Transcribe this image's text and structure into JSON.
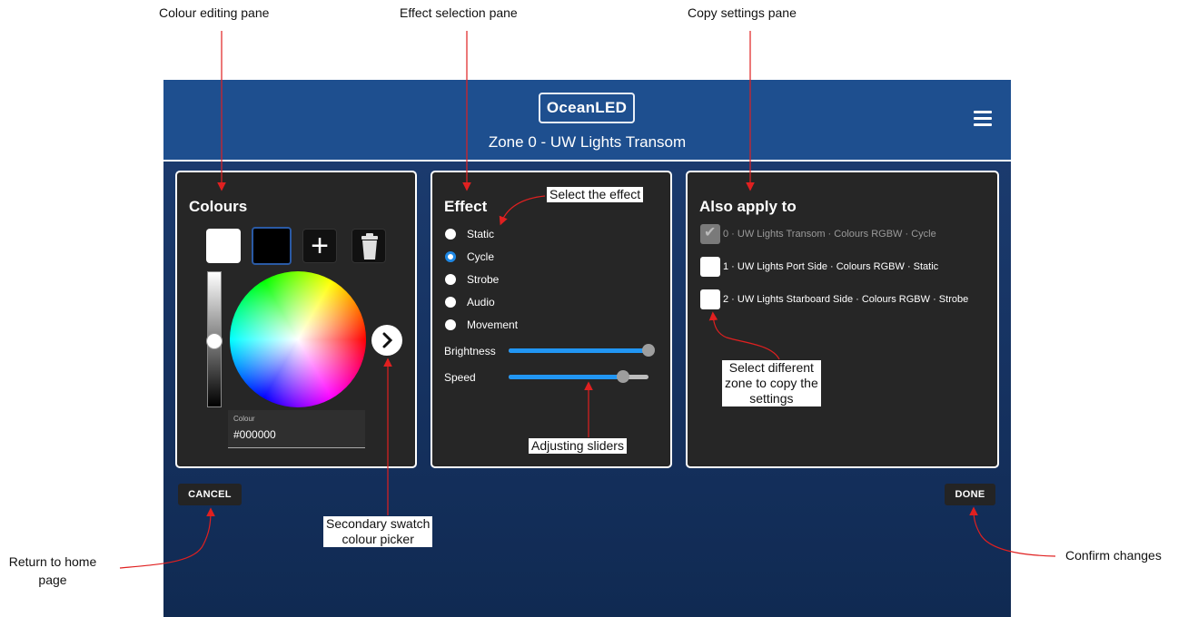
{
  "callouts": {
    "colour_pane": "Colour editing pane",
    "effect_pane": "Effect selection pane",
    "copy_pane": "Copy settings pane",
    "select_effect": "Select the effect",
    "adjusting_sliders": "Adjusting sliders",
    "select_zone": [
      "Select different",
      "zone to copy the",
      "settings"
    ],
    "secondary_swatch": [
      "Secondary swatch",
      "colour picker"
    ],
    "return_home": [
      "Return to home",
      "page"
    ],
    "confirm": "Confirm changes"
  },
  "header": {
    "logo": "OceanLED",
    "zone_title": "Zone 0 - UW Lights Transom",
    "menu_icon": "hamburger-menu-icon"
  },
  "colours": {
    "title": "Colours",
    "swatches": [
      {
        "name": "white",
        "color": "#ffffff"
      },
      {
        "name": "black",
        "color": "#000000",
        "selected": true
      }
    ],
    "add_icon": "plus-icon",
    "delete_icon": "trash-icon",
    "brightness_level": 0.5,
    "field_label": "Colour",
    "field_value": "#000000"
  },
  "effect": {
    "title": "Effect",
    "options": [
      "Static",
      "Cycle",
      "Strobe",
      "Audio",
      "Movement"
    ],
    "selected": "Cycle",
    "sliders": [
      {
        "label": "Brightness",
        "value": 1.0
      },
      {
        "label": "Speed",
        "value": 0.82
      }
    ]
  },
  "apply": {
    "title": "Also apply to",
    "zones": [
      {
        "label": "0 · UW Lights Transom · Colours RGBW · Cycle",
        "checked": true,
        "disabled": true
      },
      {
        "label": "1 · UW Lights Port Side · Colours RGBW · Static",
        "checked": false,
        "disabled": false
      },
      {
        "label": "2 · UW Lights Starboard Side · Colours RGBW · Strobe",
        "checked": false,
        "disabled": false
      }
    ]
  },
  "buttons": {
    "cancel": "CANCEL",
    "done": "DONE"
  },
  "colors": {
    "header_blue": "#1e4f8f",
    "accent": "#2196f3",
    "pane_bg": "#262626",
    "annotation_red": "#e02020"
  }
}
